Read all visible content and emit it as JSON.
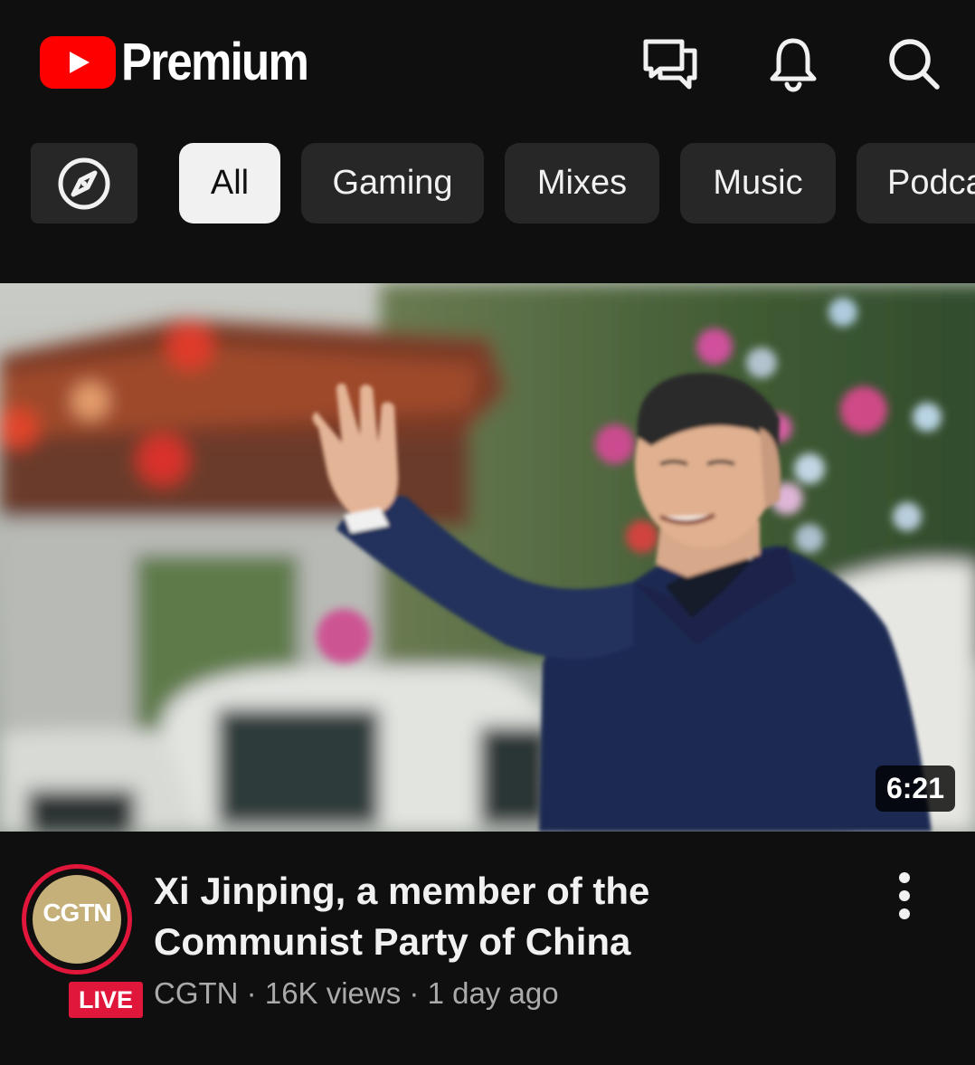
{
  "header": {
    "brand": "Premium",
    "icons": [
      "cast-icon",
      "bell-icon",
      "search-icon"
    ]
  },
  "chips": {
    "explore_icon": "compass-icon",
    "items": [
      "All",
      "Gaming",
      "Mixes",
      "Music",
      "Podca"
    ],
    "active": "All"
  },
  "video": {
    "duration": "6:21",
    "title": "Xi Jinping, a member of the Communist Party of China",
    "channel": "CGTN",
    "views": "16K views",
    "age": "1 day ago",
    "separator": "·",
    "avatar_logo": "CGTN",
    "live_badge": "LIVE"
  },
  "colors": {
    "background": "#0f0f0f",
    "chip": "#272727",
    "chip_active": "#f1f1f1",
    "brand_red": "#ff0000",
    "live_red": "#e0163a",
    "secondary_text": "#aaaaaa"
  }
}
